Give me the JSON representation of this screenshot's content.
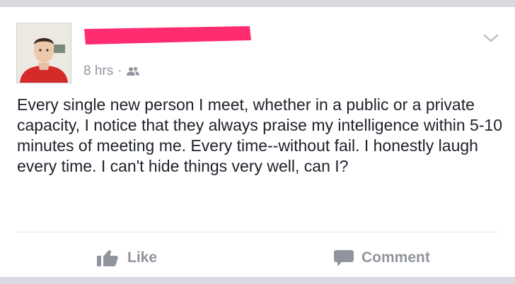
{
  "post": {
    "time": "8 hrs",
    "separator": "·",
    "audience_icon": "friends-icon",
    "text": "Every single new person I meet, whether in a public or a private capacity, I notice that they always praise my intelligence within 5-10 minutes of meeting me. Every time--without fail. I honestly laugh every time. I can't hide things very well, can I?"
  },
  "actions": {
    "like_label": "Like",
    "like_icon": "thumbs-up-icon",
    "comment_label": "Comment",
    "comment_icon": "speech-bubble-icon"
  },
  "colors": {
    "redaction": "#ff2d6f",
    "muted_text": "#90949c",
    "body_text": "#1d2129",
    "page_bg": "#d9dadf"
  }
}
